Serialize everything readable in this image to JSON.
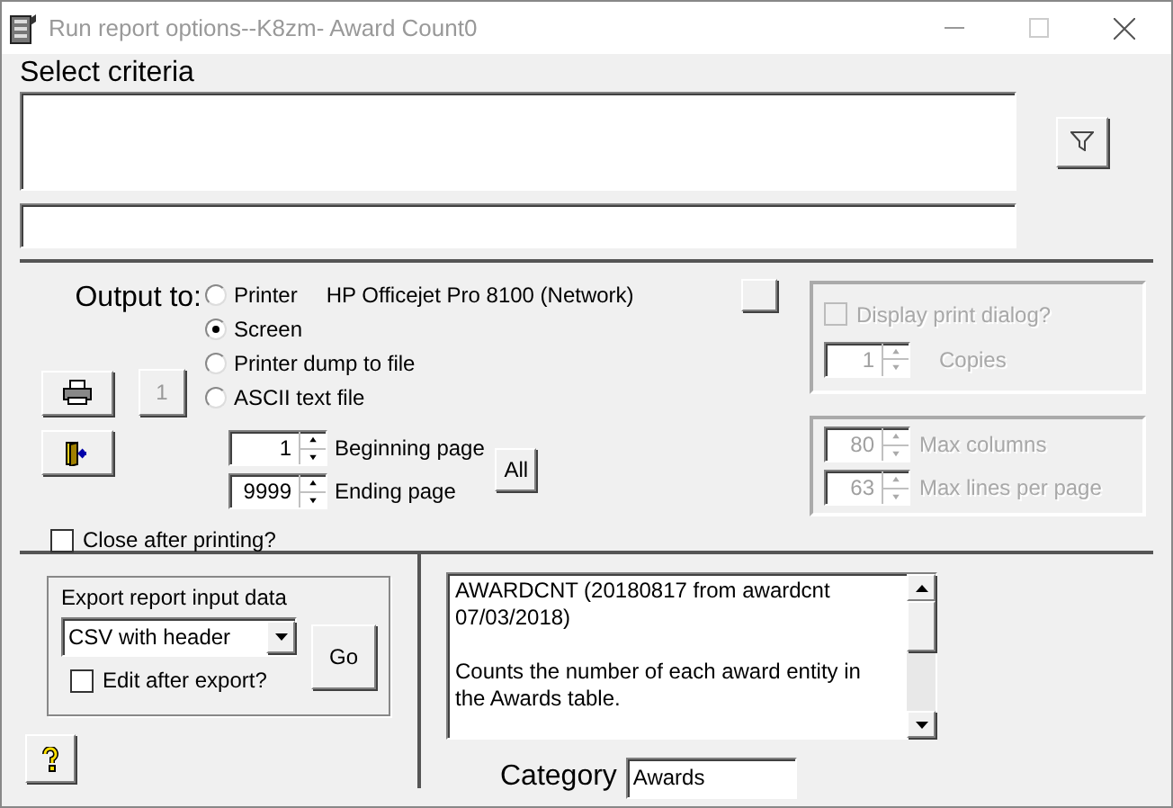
{
  "window": {
    "title": "Run report options--K8zm- Award Count0"
  },
  "criteria": {
    "label": "Select criteria"
  },
  "output": {
    "label": "Output to:",
    "options": [
      {
        "label": "Printer",
        "selected": false,
        "detail": "HP Officejet Pro 8100 (Network)"
      },
      {
        "label": "Screen",
        "selected": true
      },
      {
        "label": "Printer dump to file",
        "selected": false
      },
      {
        "label": "ASCII text file",
        "selected": false
      }
    ],
    "copies_button": "1",
    "beginning_page": {
      "value": "1",
      "label": "Beginning page"
    },
    "ending_page": {
      "value": "9999",
      "label": "Ending page"
    },
    "all_button": "All",
    "close_after_printing": {
      "label": "Close after printing?",
      "checked": false
    }
  },
  "print_options": {
    "disabled": true,
    "display_print_dialog": {
      "label": "Display print dialog?",
      "checked": false
    },
    "copies": {
      "value": "1",
      "label": "Copies"
    },
    "max_columns": {
      "value": "80",
      "label": "Max columns"
    },
    "max_lines": {
      "value": "63",
      "label": "Max lines per page"
    }
  },
  "export": {
    "title": "Export report input data",
    "format": "CSV with header",
    "edit_after_export": {
      "label": "Edit after export?",
      "checked": false
    },
    "go_button": "Go"
  },
  "description": [
    "AWARDCNT (20180817 from awardcnt 07/03/2018)",
    "Counts the number of each award entity in the Awards table."
  ],
  "category": {
    "label": "Category",
    "value": "Awards"
  }
}
